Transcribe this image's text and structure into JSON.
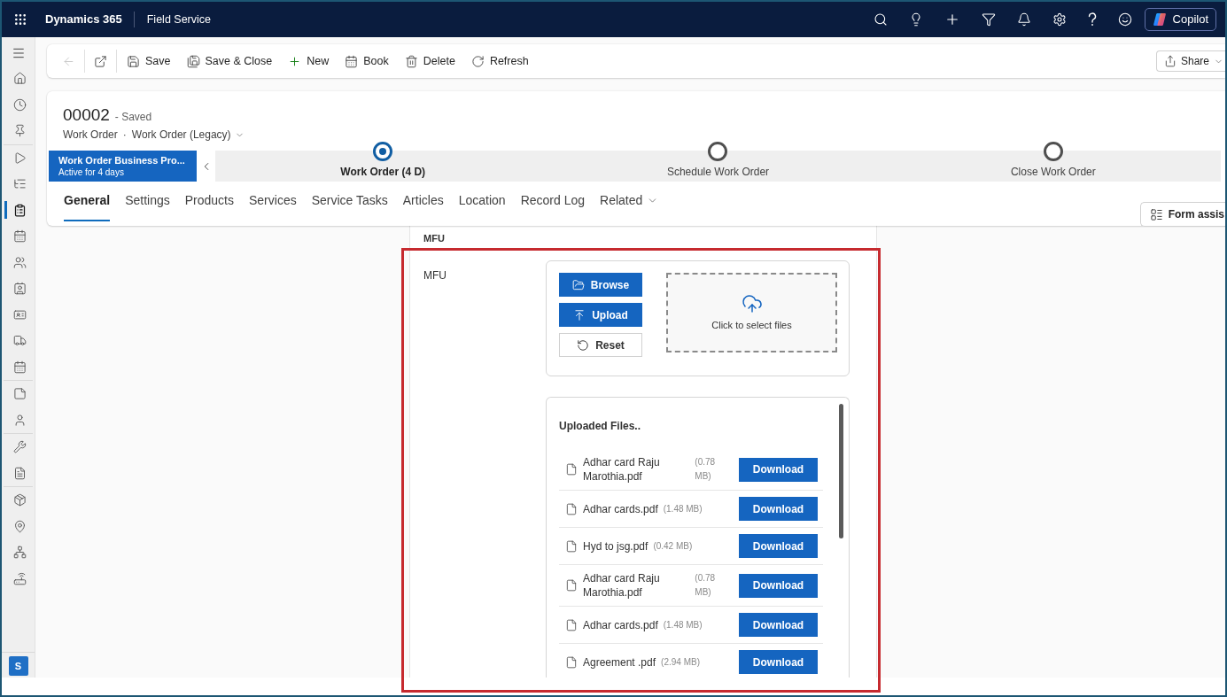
{
  "app_bar": {
    "app_name": "Dynamics 365",
    "area": "Field Service",
    "copilot_label": "Copilot"
  },
  "sidebar": {
    "groups": [
      {
        "items": [
          {
            "kind": "home",
            "selected": false
          },
          {
            "kind": "clock",
            "selected": false
          },
          {
            "kind": "pin",
            "selected": false
          }
        ]
      },
      {
        "items": [
          {
            "kind": "play",
            "selected": false
          },
          {
            "kind": "tree",
            "selected": false
          },
          {
            "kind": "clipboard",
            "selected": true
          },
          {
            "kind": "calendar",
            "selected": false
          },
          {
            "kind": "people",
            "selected": false
          },
          {
            "kind": "contact",
            "selected": false
          },
          {
            "kind": "card",
            "selected": false
          },
          {
            "kind": "truck",
            "selected": false
          },
          {
            "kind": "calendar",
            "selected": false
          }
        ]
      },
      {
        "items": [
          {
            "kind": "note",
            "selected": false
          },
          {
            "kind": "person",
            "selected": false
          }
        ]
      },
      {
        "items": [
          {
            "kind": "wrench",
            "selected": false
          },
          {
            "kind": "document",
            "selected": false
          }
        ]
      },
      {
        "items": [
          {
            "kind": "package",
            "selected": false
          },
          {
            "kind": "mappin",
            "selected": false
          },
          {
            "kind": "network",
            "selected": false
          },
          {
            "kind": "router",
            "selected": false
          }
        ]
      }
    ],
    "avatar": "S"
  },
  "command_bar": {
    "back_disabled": true,
    "commands": [
      {
        "kind": "save",
        "label": "Save"
      },
      {
        "kind": "saveclose",
        "label": "Save & Close"
      },
      {
        "kind": "new",
        "label": "New"
      },
      {
        "kind": "book",
        "label": "Book"
      },
      {
        "kind": "delete",
        "label": "Delete"
      },
      {
        "kind": "refresh",
        "label": "Refresh"
      }
    ],
    "share_label": "Share"
  },
  "record": {
    "number": "00002",
    "status": "- Saved",
    "entity": "Work Order",
    "separator": "·",
    "form": "Work Order (Legacy)"
  },
  "process": {
    "name": "Work Order Business Pro...",
    "active_for": "Active for 4 days",
    "stages": [
      {
        "label": "Work Order (4 D)",
        "selected": true
      },
      {
        "label": "Schedule Work Order",
        "selected": false
      },
      {
        "label": "Close Work Order",
        "selected": false
      }
    ]
  },
  "tabs": [
    {
      "label": "General",
      "selected": true,
      "has_menu": false
    },
    {
      "label": "Settings",
      "selected": false,
      "has_menu": false
    },
    {
      "label": "Products",
      "selected": false,
      "has_menu": false
    },
    {
      "label": "Services",
      "selected": false,
      "has_menu": false
    },
    {
      "label": "Service Tasks",
      "selected": false,
      "has_menu": false
    },
    {
      "label": "Articles",
      "selected": false,
      "has_menu": false
    },
    {
      "label": "Location",
      "selected": false,
      "has_menu": false
    },
    {
      "label": "Record Log",
      "selected": false,
      "has_menu": false
    },
    {
      "label": "Related",
      "selected": false,
      "has_menu": true
    }
  ],
  "form_assist": "Form assis",
  "section": {
    "previous_label": "MFU",
    "field_label": "MFU",
    "upload_buttons": [
      {
        "kind": "browse",
        "label": "Browse"
      },
      {
        "kind": "upload",
        "label": "Upload"
      },
      {
        "kind": "reset",
        "label": "Reset"
      }
    ],
    "dropzone_text": "Click to select files",
    "uploaded": {
      "title": "Uploaded Files..",
      "files": [
        {
          "name": "Adhar card Raju Marothia.pdf",
          "size": "(0.78 MB)",
          "action": "Download"
        },
        {
          "name": "Adhar cards.pdf",
          "size": "(1.48 MB)",
          "action": "Download"
        },
        {
          "name": "Hyd to jsg.pdf",
          "size": "(0.42 MB)",
          "action": "Download"
        },
        {
          "name": "Adhar card Raju Marothia.pdf",
          "size": "(0.78 MB)",
          "action": "Download"
        },
        {
          "name": "Adhar cards.pdf",
          "size": "(1.48 MB)",
          "action": "Download"
        },
        {
          "name": "Agreement .pdf",
          "size": "(2.94 MB)",
          "action": "Download"
        }
      ]
    }
  }
}
